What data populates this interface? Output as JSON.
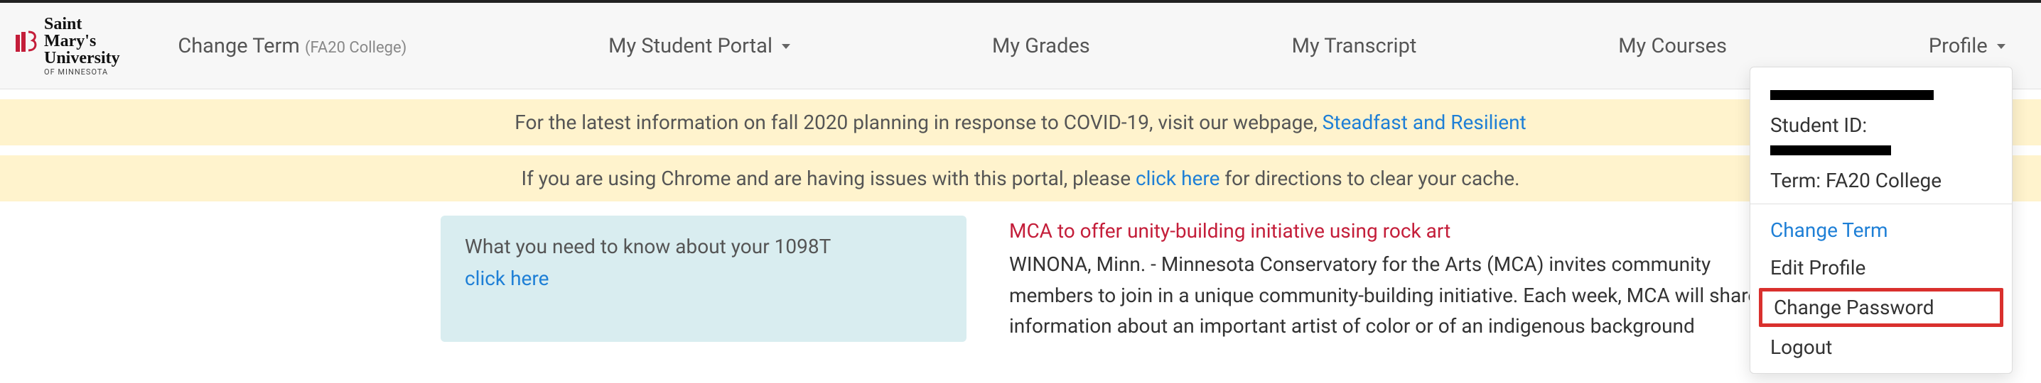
{
  "brand": {
    "name_line1": "Saint Mary's",
    "name_line2": "University",
    "name_sub": "OF MINNESOTA"
  },
  "nav": {
    "change_term_label": "Change Term",
    "change_term_paren": "(FA20 College)",
    "student_portal": "My Student Portal",
    "grades": "My Grades",
    "transcript": "My Transcript",
    "courses": "My Courses",
    "profile": "Profile"
  },
  "banners": {
    "covid_prefix": "For the latest information on fall 2020 planning in response to COVID-19, visit our webpage, ",
    "covid_link": "Steadfast and Resilient",
    "chrome_prefix": "If you are using Chrome and are having issues with this portal, please ",
    "chrome_link": "click here",
    "chrome_suffix": " for directions to clear your cache."
  },
  "info_card": {
    "line1": "What you need to know about your 1098T",
    "link": "click here"
  },
  "news": {
    "title": "MCA to offer unity-building initiative using rock art",
    "body": "WINONA, Minn. - Minnesota Conservatory for the Arts (MCA) invites community members to join in a unique community-building initiative. Each week, MCA will share information about an important artist of color or of an indigenous background"
  },
  "profile_menu": {
    "student_id_label": "Student ID:",
    "term_label": "Term: FA20 College",
    "change_term": "Change Term",
    "edit_profile": "Edit Profile",
    "change_password": "Change Password",
    "logout": "Logout"
  }
}
